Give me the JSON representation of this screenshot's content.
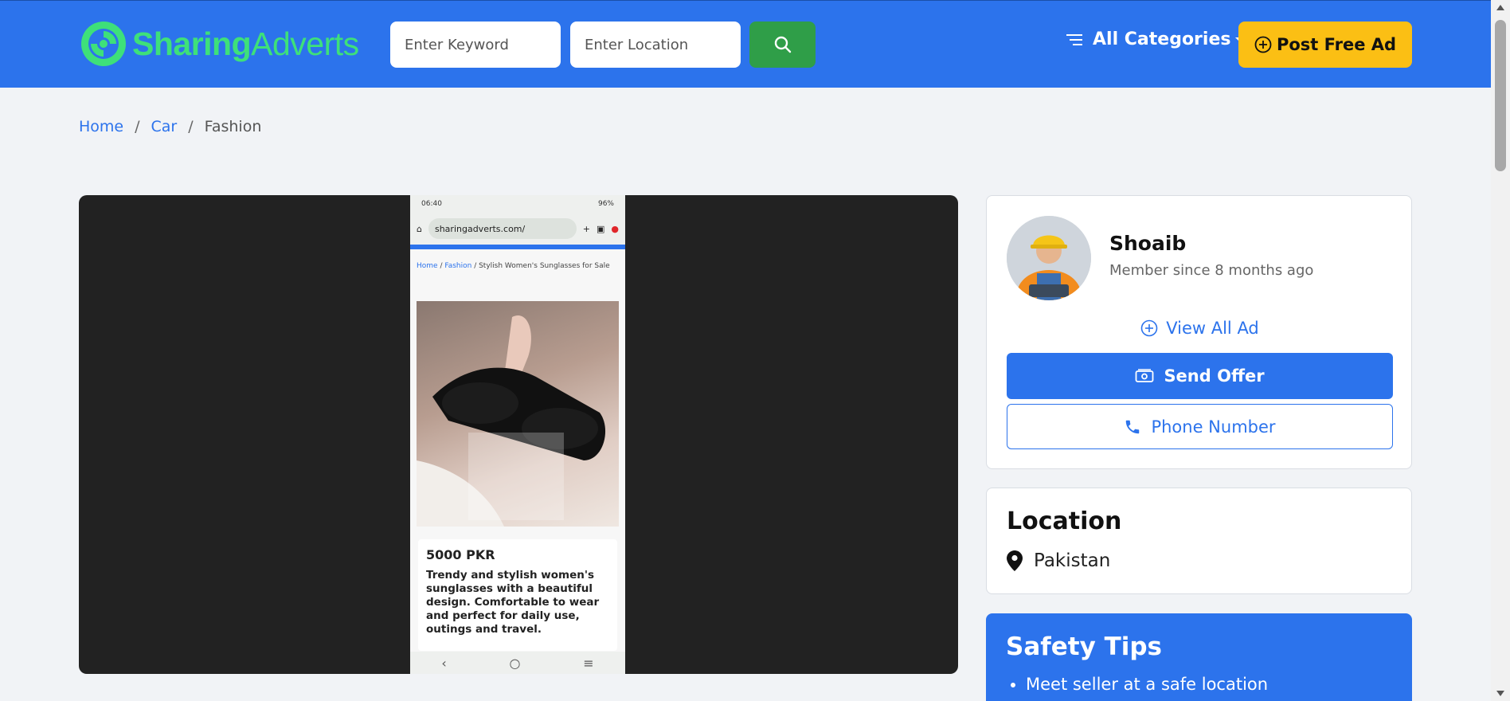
{
  "header": {
    "logo_part1": "Sharing",
    "logo_part2": "Adverts",
    "keyword_placeholder": "Enter Keyword",
    "location_placeholder": "Enter Location",
    "categories_label": "All Categories",
    "post_ad_label": "Post Free Ad"
  },
  "breadcrumb": {
    "items": [
      "Home",
      "Car"
    ],
    "current": "Fashion",
    "separator": "/"
  },
  "media": {
    "phone_status_time": "06:40",
    "phone_status_right": "96%",
    "phone_url": "sharingadverts.com/",
    "phone_crumb_home": "Home",
    "phone_crumb_fashion": "Fashion",
    "phone_crumb_title": "Stylish Women's Sunglasses for Sale",
    "phone_price": "5000 PKR",
    "phone_desc": "Trendy and stylish women's sunglasses with a beautiful design. Comfortable to wear and perfect for daily use, outings and travel."
  },
  "seller": {
    "name": "Shoaib",
    "member_since": "Member since 8 months ago",
    "view_all_label": "View All Ad",
    "send_offer_label": "Send Offer",
    "phone_label": "Phone Number"
  },
  "location": {
    "title": "Location",
    "value": "Pakistan"
  },
  "safety": {
    "title": "Safety Tips",
    "tips": [
      "Meet seller at a safe location"
    ]
  },
  "colors": {
    "brand_blue": "#2c73ec",
    "logo_green": "#3ee07a",
    "search_green": "#2f9e48",
    "post_yellow": "#fbbf14"
  }
}
